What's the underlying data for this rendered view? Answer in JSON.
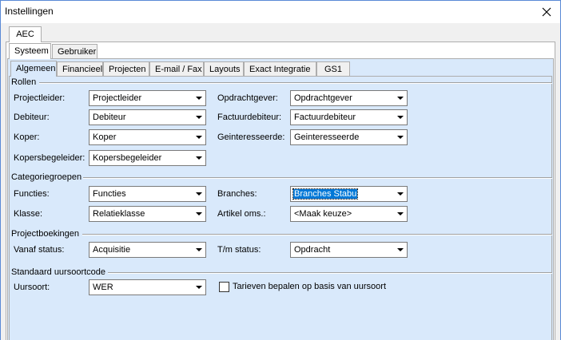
{
  "window": {
    "title": "Instellingen"
  },
  "tabs_top": [
    "AEC"
  ],
  "tabs_level2": [
    "Systeem",
    "Gebruiker"
  ],
  "tabs_level3": [
    "Algemeen",
    "Financieel",
    "Projecten",
    "E-mail / Fax",
    "Layouts",
    "Exact Integratie",
    "GS1"
  ],
  "groups": {
    "rollen": "Rollen",
    "categoriegroepen": "Categoriegroepen",
    "projectboekingen": "Projectboekingen",
    "uursoort": "Standaard uursoortcode"
  },
  "fields": {
    "projectleider": {
      "label": "Projectleider:",
      "value": "Projectleider"
    },
    "opdrachtgever": {
      "label": "Opdrachtgever:",
      "value": "Opdrachtgever"
    },
    "debiteur": {
      "label": "Debiteur:",
      "value": "Debiteur"
    },
    "factuurdebiteur": {
      "label": "Factuurdebiteur:",
      "value": "Factuurdebiteur"
    },
    "koper": {
      "label": "Koper:",
      "value": "Koper"
    },
    "geinteresseerde": {
      "label": "Geinteresseerde:",
      "value": "Geinteresseerde"
    },
    "kopersbegeleider": {
      "label": "Kopersbegeleider:",
      "value": "Kopersbegeleider"
    },
    "functies": {
      "label": "Functies:",
      "value": "Functies"
    },
    "branches": {
      "label": "Branches:",
      "value": "Branches Stabu"
    },
    "klasse": {
      "label": "Klasse:",
      "value": "Relatieklasse"
    },
    "artikel_oms": {
      "label": "Artikel oms.:",
      "value": "<Maak keuze>"
    },
    "vanaf_status": {
      "label": "Vanaf status:",
      "value": "Acquisitie"
    },
    "tm_status": {
      "label": "T/m status:",
      "value": "Opdracht"
    },
    "uursoort": {
      "label": "Uursoort:",
      "value": "WER"
    }
  },
  "checkbox": {
    "label": "Tarieven bepalen op basis van uursoort",
    "checked": false
  }
}
